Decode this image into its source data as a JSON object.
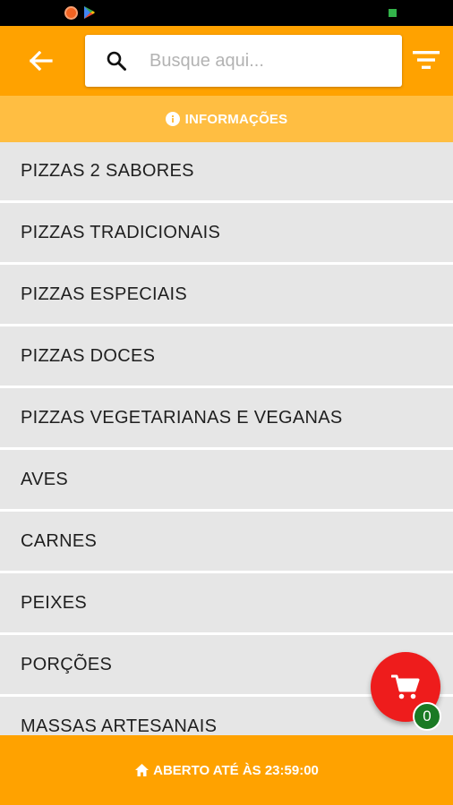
{
  "status_bar": {
    "icons": [
      "notification-app-icon",
      "play-store-icon",
      "battery-icon"
    ]
  },
  "header": {
    "back_icon": "arrow-left-icon",
    "search": {
      "placeholder": "Busque aqui...",
      "value": ""
    },
    "filter_icon": "filter-icon"
  },
  "info_bar": {
    "label": "INFORMAÇÕES",
    "icon": "info-icon"
  },
  "categories": [
    {
      "label": "PIZZAS 2 SABORES"
    },
    {
      "label": "PIZZAS TRADICIONAIS"
    },
    {
      "label": "PIZZAS ESPECIAIS"
    },
    {
      "label": "PIZZAS DOCES"
    },
    {
      "label": "PIZZAS VEGETARIANAS E VEGANAS"
    },
    {
      "label": "AVES"
    },
    {
      "label": "CARNES"
    },
    {
      "label": "PEIXES"
    },
    {
      "label": "PORÇÕES"
    },
    {
      "label": "MASSAS ARTESANAIS"
    }
  ],
  "cart": {
    "count": "0",
    "icon": "cart-icon"
  },
  "footer": {
    "label": "ABERTO ATÉ ÀS 23:59:00",
    "icon": "home-icon"
  },
  "colors": {
    "primary": "#ffa200",
    "info_bar": "#ffbe42",
    "list_item": "#e6e6e6",
    "cart_fab": "#ee1c1c",
    "cart_badge": "#1a7a24"
  }
}
